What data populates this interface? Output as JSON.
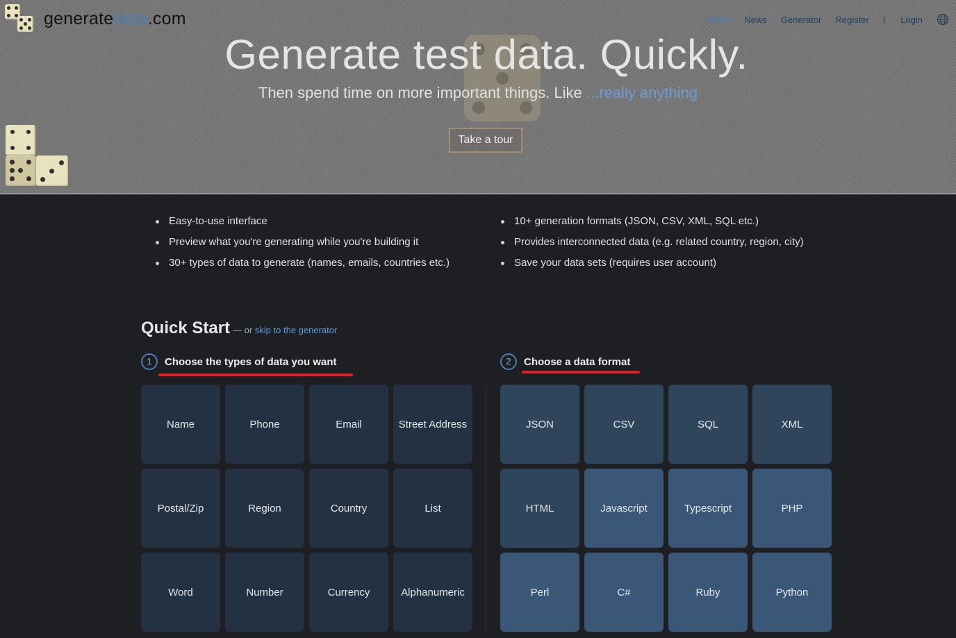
{
  "logo": {
    "part1": "generate",
    "part2": "data",
    "part3": ".com"
  },
  "nav": {
    "items": [
      "Home",
      "News",
      "Generator",
      "Register"
    ],
    "separator": "|",
    "login": "Login",
    "globe_icon": "globe-icon"
  },
  "hero": {
    "title": "Generate test data. Quickly.",
    "subtitle": "Then spend time on more important things. Like",
    "subtitle_highlight": "...really anything",
    "tour_button": "Take a tour"
  },
  "features": {
    "left": [
      "Easy-to-use interface",
      "Preview what you're generating while you're building it",
      "30+ types of data to generate (names, emails, countries etc.)"
    ],
    "right": [
      "10+ generation formats (JSON, CSV, XML, SQL etc.)",
      "Provides interconnected data (e.g. related country, region, city)",
      "Save your data sets (requires user account)"
    ]
  },
  "quick_start": {
    "title": "Quick Start",
    "or_text": "— or",
    "skip_link": "skip to the generator",
    "step1": {
      "num": "1",
      "label": "Choose the types of data you want"
    },
    "step2": {
      "num": "2",
      "label": "Choose a data format"
    },
    "data_types": [
      "Name",
      "Phone",
      "Email",
      "Street Address",
      "Postal/Zip",
      "Region",
      "Country",
      "List",
      "Word",
      "Number",
      "Currency",
      "Alphanumeric"
    ],
    "formats": [
      "JSON",
      "CSV",
      "SQL",
      "XML",
      "HTML",
      "Javascript",
      "Typescript",
      "PHP",
      "Perl",
      "C#",
      "Ruby",
      "Python"
    ]
  },
  "colors": {
    "accent": "#3d7fc4",
    "underline": "#e0202a",
    "tile_data": "#233142",
    "tile_format": "#3a5777",
    "background": "#1d1f23"
  }
}
